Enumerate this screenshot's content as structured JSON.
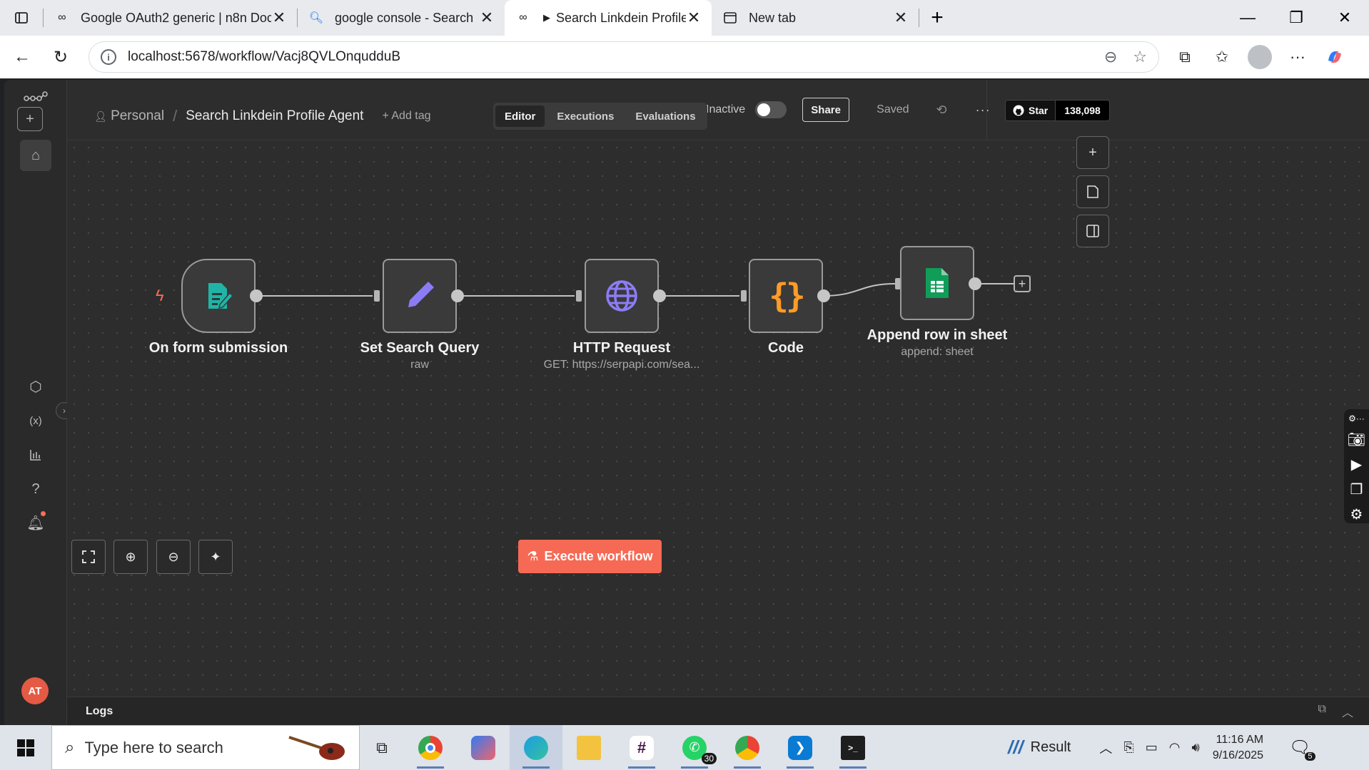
{
  "browser": {
    "tabs": [
      {
        "title": "Google OAuth2 generic | n8n Doc",
        "active": false
      },
      {
        "title": "google console - Search",
        "active": false
      },
      {
        "title": "Search Linkdein Profile Agent -",
        "active": true
      },
      {
        "title": "New tab",
        "active": false
      }
    ],
    "url": "localhost:5678/workflow/Vacj8QVLOnqudduB"
  },
  "header": {
    "project": "Personal",
    "workflow_name": "Search Linkdein Profile Agent",
    "add_tag": "+ Add tag",
    "status": "Inactive",
    "share": "Share",
    "saved": "Saved",
    "more": "···",
    "github_star": "Star",
    "github_count": "138,098"
  },
  "mode_tabs": [
    {
      "label": "Editor",
      "active": true
    },
    {
      "label": "Executions",
      "active": false
    },
    {
      "label": "Evaluations",
      "active": false
    }
  ],
  "nodes": [
    {
      "name": "On form submission",
      "subtitle": "",
      "icon": "form-icon",
      "color": "#1fb5a6"
    },
    {
      "name": "Set Search Query",
      "subtitle": "raw",
      "icon": "pencil-icon",
      "color": "#8b7cf6"
    },
    {
      "name": "HTTP Request",
      "subtitle": "GET: https://serpapi.com/sea...",
      "icon": "globe-icon",
      "color": "#8b7cf6"
    },
    {
      "name": "Code",
      "subtitle": "",
      "icon": "braces-icon",
      "color": "#ff9b26"
    },
    {
      "name": "Append row in sheet",
      "subtitle": "append: sheet",
      "icon": "google-sheets-icon",
      "color": "#0f9d58"
    }
  ],
  "canvas": {
    "execute_button": "Execute workflow"
  },
  "logs": {
    "title": "Logs"
  },
  "user": {
    "initials": "AT"
  },
  "taskbar": {
    "search_placeholder": "Type here to search",
    "whatsapp_badge": "30",
    "result_label": "Result",
    "time": "11:16 AM",
    "date": "9/16/2025",
    "notifications": "5"
  }
}
